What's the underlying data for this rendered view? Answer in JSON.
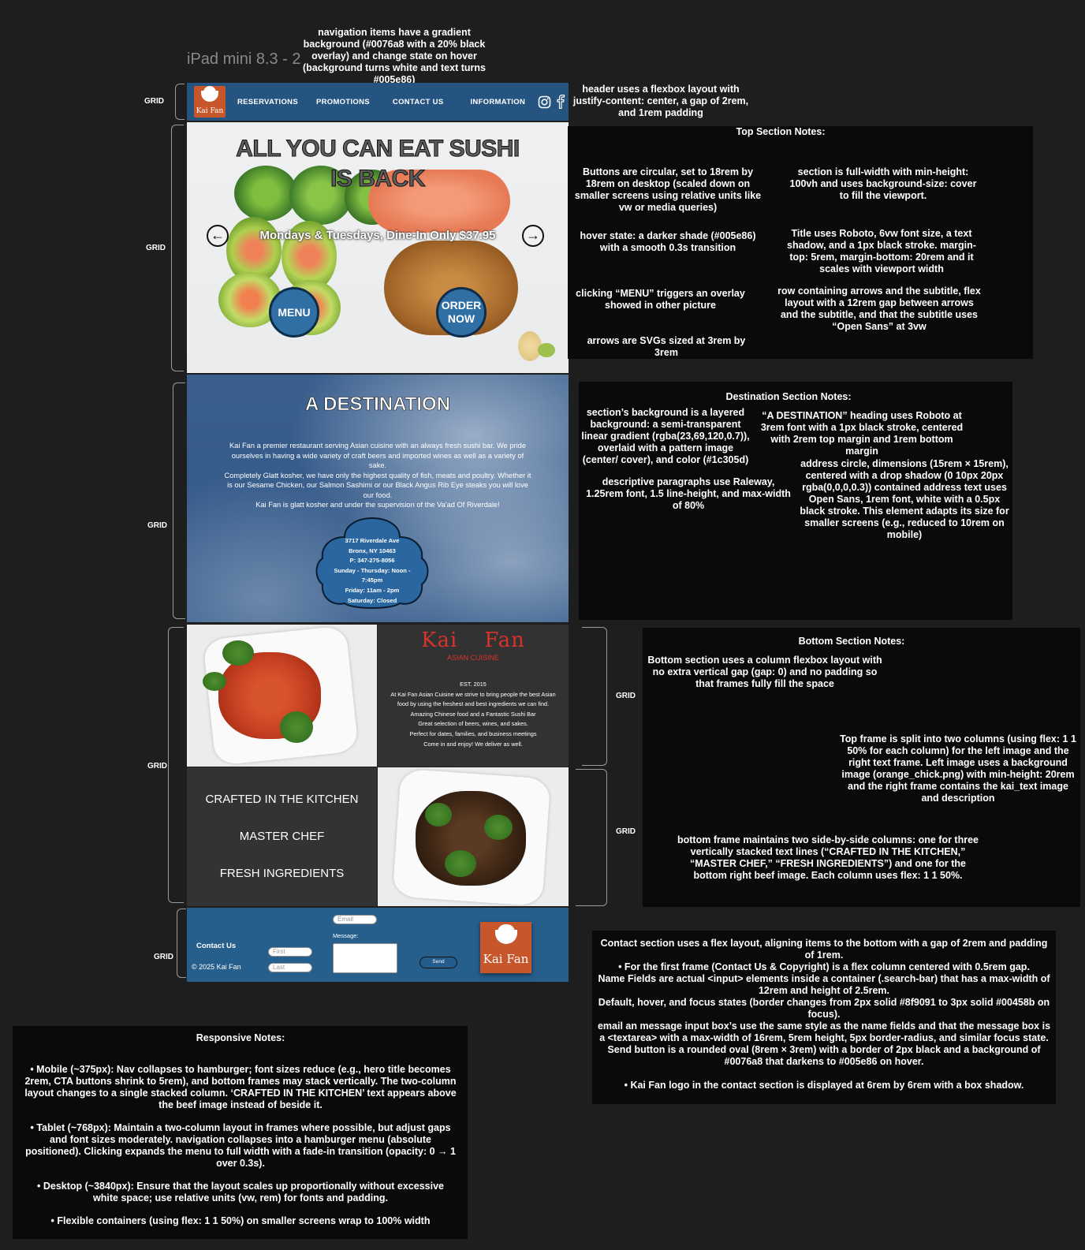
{
  "frame_title": "iPad mini 8.3 - 2",
  "grid_label": "GRID",
  "header": {
    "logo_text": "Kai Fan",
    "nav_items": [
      "RESERVATIONS",
      "PROMOTIONS",
      "CONTACT US",
      "INFORMATION"
    ],
    "icons": [
      "instagram-icon",
      "facebook-icon"
    ]
  },
  "hero": {
    "title_line1": "ALL YOU CAN EAT SUSHI",
    "title_line2": "IS BACK",
    "subtitle": "Mondays & Tuesdays, Dine-In Only $37.95",
    "menu_button": "MENU",
    "order_button_line1": "ORDER",
    "order_button_line2": "NOW",
    "arrow_left": "arrow-left-icon",
    "arrow_right": "arrow-right-icon"
  },
  "destination": {
    "heading": "A DESTINATION",
    "paragraphs": [
      "Kai Fan a premier restaurant serving Asian cuisine with an always fresh sushi bar. We pride ourselves in having a wide variety of craft beers and imported wines as well as a variety of sake.",
      "Completely Glatt kosher, we have only the highest quality of fish, meats and poultry. Whether it is our Sesame Chicken, our Salmon Sashimi or our Black Angus Rib Eye steaks you will love our food.",
      "Kai Fan is glatt kosher and under the supervision of the Va'ad Of Riverdale!"
    ],
    "address": [
      "3717 Riverdale Ave",
      "Bronx, NY 10463",
      "P: 347-275-8056",
      "Sunday - Thursday: Noon -",
      "7:45pm",
      "Friday: 11am - 2pm",
      "Saturday: Closed"
    ]
  },
  "about": {
    "logo_line1": "Kai",
    "logo_line2": "Fan",
    "logo_subtitle": "ASIAN CUISINE",
    "est": "EST. 2015",
    "lines": [
      "At Kai Fan Asian Cuisine we strive to bring people the best Asian",
      "food by using the freshest and best ingredients we can find.",
      "Amazing Chinese food and a Fantastic Sushi Bar",
      "Great selection of beers, wines, and sakes.",
      "Perfect for dates, families, and business meetings",
      "Come in and enjoy! We deliver as well."
    ]
  },
  "crafted": {
    "lines": [
      "CRAFTED IN THE KITCHEN",
      "MASTER CHEF",
      "FRESH INGREDIENTS"
    ]
  },
  "contact": {
    "title": "Contact Us",
    "copyright": "© 2025 Kai Fan",
    "first_placeholder": "First",
    "last_placeholder": "Last",
    "email_placeholder": "Email",
    "message_label": "Message:",
    "send_label": "Send",
    "logo_text": "Kai Fan"
  },
  "notes": {
    "nav": "navigation items have a gradient background (#0076a8 with a 20% black overlay) and change state on hover (background turns white and text turns #005e86)",
    "header": "header uses a flexbox layout with justify-content: center, a gap of 2rem, and 1rem padding",
    "top_title": "Top Section Notes:",
    "top_buttons": "Buttons are circular, set to 18rem by 18rem on desktop (scaled down on smaller screens using relative units like vw or media queries)",
    "top_section": "section is full-width with min-height: 100vh and uses background-size: cover to fill the viewport.",
    "top_hover": "hover state: a darker shade (#005e86) with a smooth 0.3s transition",
    "top_titlefont": "Title uses Roboto, 6vw font size, a text shadow, and a 1px black stroke. margin-top: 5rem, margin-bottom: 20rem and it scales with viewport width",
    "top_menu": "clicking “MENU” triggers an overlay showed in other picture",
    "top_row": "row containing arrows and the subtitle,  flex layout with a 12rem gap between arrows and the subtitle, and that the subtitle uses “Open Sans” at 3vw",
    "top_arrows": "arrows are SVGs sized at 3rem by 3rem",
    "dest_title": "Destination Section Notes:",
    "dest_bg": "section’s background is a layered background: a semi-transparent linear gradient (rgba(23,69,120,0.7)), overlaid with a pattern image (center/ cover), and  color (#1c305d)",
    "dest_heading": "“A DESTINATION” heading uses Roboto at 3rem font with a 1px black stroke, centered with 2rem top margin and 1rem bottom margin",
    "dest_paras": "descriptive paragraphs use Raleway, 1.25rem font, 1.5 line-height, and max-width of 80%",
    "dest_circle": "address circle,  dimensions (15rem × 15rem), centered with a drop shadow (0 10px 20px rgba(0,0,0,0.3)) contained address text uses Open Sans, 1rem font, white with a 0.5px black stroke. This element adapts its size for smaller screens (e.g., reduced to 10rem on mobile)",
    "bottom_title": "Bottom Section Notes:",
    "bottom_col": "Bottom section uses a column flexbox layout with no extra vertical gap (gap: 0) and no padding so that frames fully fill the space",
    "bottom_top": "Top frame is split into two columns (using flex: 1 1 50% for each column) for the left image and the right text frame. Left image uses a background image (orange_chick.png) with min-height: 20rem and the right frame contains the kai_text image and description",
    "bottom_bottom": "bottom frame maintains two side-by-side columns: one for three vertically stacked text lines (“CRAFTED IN THE KITCHEN,” “MASTER CHEF,” “FRESH INGREDIENTS”) and one for the bottom right beef image. Each column uses flex: 1 1 50%.",
    "contact_lines": [
      "Contact section uses a flex layout, aligning items to the bottom with a gap of 2rem and padding of 1rem.",
      "• For the first frame (Contact Us & Copyright) is a flex column centered with 0.5rem gap.",
      "Name Fields are actual <input> elements inside a container (.search-bar) that has a max-width of 12rem and height of 2.5rem.",
      "Default, hover, and focus states (border changes from 2px solid #8f9091 to 3px solid #00458b on focus).",
      "email an message input box’s use the same style as the name fields and that the message box is a <textarea> with a max-width of 16rem, 5rem height, 5px border-radius, and similar focus state.",
      "Send button  is a rounded oval (8rem × 3rem) with a border of 2px black and a background of #0076a8 that darkens to #005e86 on hover.",
      "",
      "• Kai Fan logo in the contact section is displayed at 6rem by 6rem with a box shadow."
    ],
    "resp_title": "Responsive Notes:",
    "resp_lines": [
      "• Mobile (~375px): Nav collapses to hamburger; font sizes reduce (e.g., hero title becomes 2rem, CTA buttons shrink to 5rem), and bottom frames may stack vertically. The two-column layout changes to a single stacked column. ‘CRAFTED IN THE KITCHEN’ text appears above the beef image instead of beside it.",
      "• Tablet (~768px): Maintain a two-column layout in frames where possible, but adjust gaps and font sizes moderately. navigation collapses into a hamburger menu (absolute positioned). Clicking expands the menu to full width with a fade-in transition (opacity: 0 → 1 over 0.3s).",
      "• Desktop (~3840px): Ensure that the layout scales up proportionally without excessive white space; use relative units (vw, rem) for fonts and padding.",
      "• Flexible containers (using flex: 1 1 50%)  on smaller screens  wrap to 100% width"
    ]
  }
}
